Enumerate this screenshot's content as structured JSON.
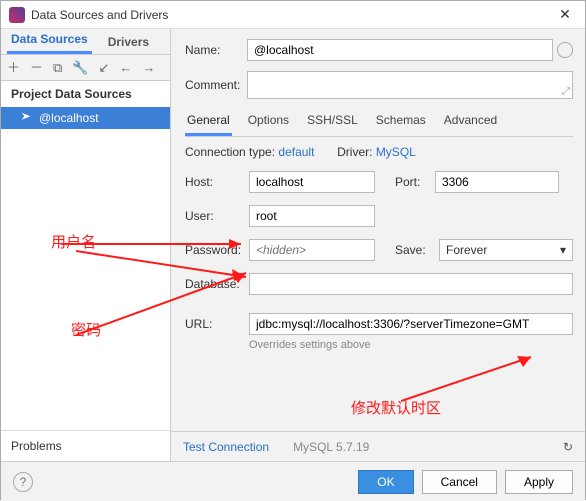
{
  "titlebar": {
    "title": "Data Sources and Drivers"
  },
  "sidebar": {
    "tabs": [
      "Data Sources",
      "Drivers"
    ],
    "section": "Project Data Sources",
    "item": "@localhost",
    "problems": "Problems"
  },
  "top": {
    "name_label": "Name:",
    "name_value": "@localhost",
    "comment_label": "Comment:"
  },
  "tabs": [
    "General",
    "Options",
    "SSH/SSL",
    "Schemas",
    "Advanced"
  ],
  "conn": {
    "ctype_label": "Connection type:",
    "ctype_value": "default",
    "driver_label": "Driver:",
    "driver_value": "MySQL"
  },
  "form": {
    "host_label": "Host:",
    "host": "localhost",
    "port_label": "Port:",
    "port": "3306",
    "user_label": "User:",
    "user": "root",
    "pw_label": "Password:",
    "pw_placeholder": "<hidden>",
    "save_label": "Save:",
    "save_value": "Forever",
    "db_label": "Database:",
    "db": "",
    "url_label": "URL:",
    "url": "jdbc:mysql://localhost:3306/?serverTimezone=GMT",
    "url_hint": "Overrides settings above"
  },
  "footer": {
    "test": "Test Connection",
    "version": "MySQL 5.7.19"
  },
  "buttons": {
    "ok": "OK",
    "cancel": "Cancel",
    "apply": "Apply"
  },
  "annotations": {
    "user": "用户名",
    "pw": "密码",
    "tz": "修改默认时区"
  }
}
